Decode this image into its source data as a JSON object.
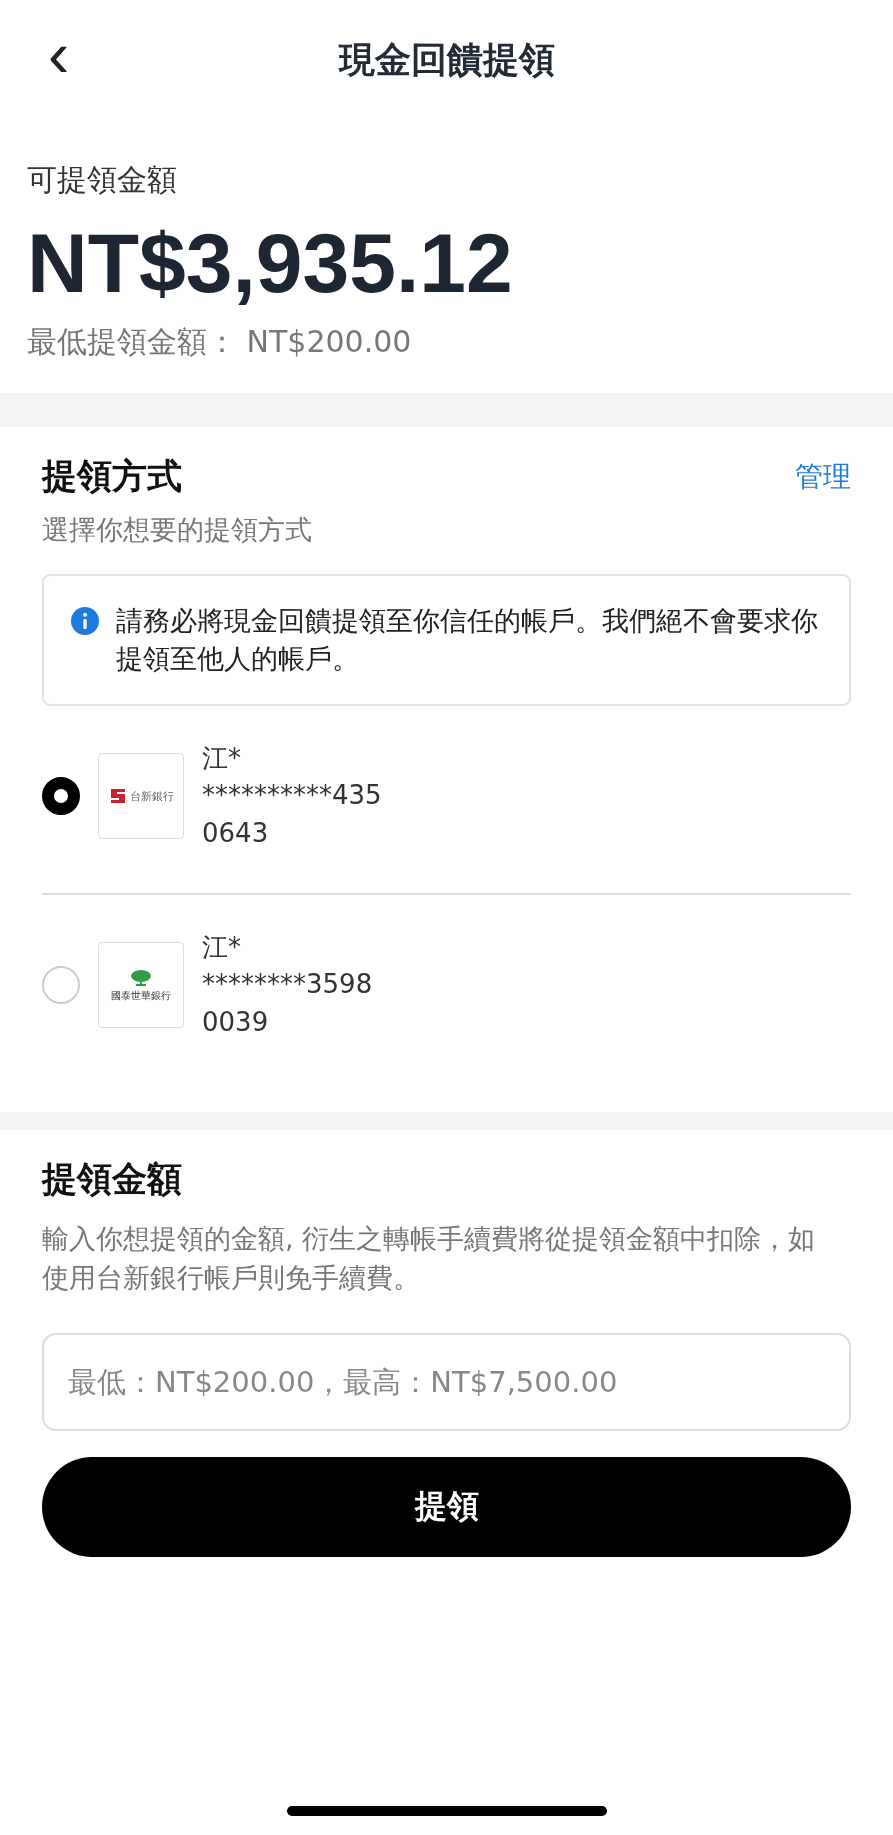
{
  "header": {
    "back_icon": "‹",
    "title": "現金回饋提領"
  },
  "balance": {
    "label": "可提領金額",
    "amount": "NT$3,935.12",
    "minimum": "最低提領金額： NT$200.00"
  },
  "method": {
    "title": "提領方式",
    "manage": "管理",
    "subtitle": "選擇你想要的提領方式",
    "notice": "請務必將現金回饋提領至你信任的帳戶。我們絕不會要求你提領至他人的帳戶。",
    "accounts": [
      {
        "bank": "台新銀行",
        "kind": "taishin",
        "name": "江*",
        "number": "**********435",
        "branch": "0643",
        "selected": true
      },
      {
        "bank": "國泰世華銀行",
        "kind": "cathay",
        "name": "江*",
        "number": "********3598",
        "branch": "0039",
        "selected": false
      }
    ]
  },
  "amount": {
    "title": "提領金額",
    "description": "輸入你想提領的金額, 衍生之轉帳手續費將從提領金額中扣除，如使用台新銀行帳戶則免手續費。",
    "placeholder": "最低：NT$200.00，最高：NT$7,500.00"
  },
  "submit": "提領"
}
